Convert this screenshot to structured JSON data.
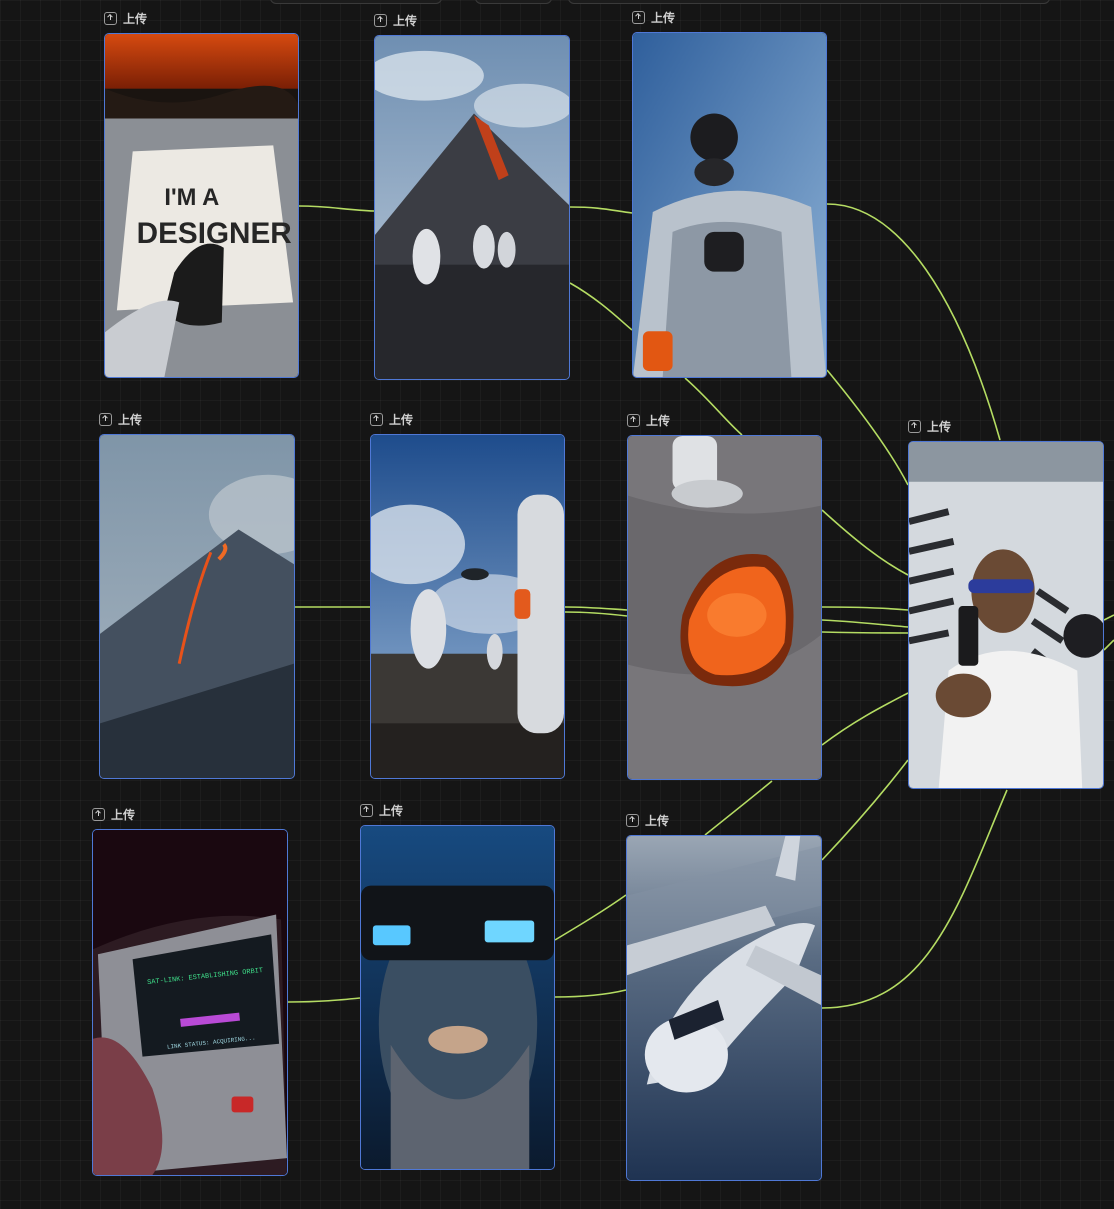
{
  "upload_label": "上传",
  "nodes": [
    {
      "id": "n1",
      "label": "上传",
      "image": "designer-sign-photo",
      "sign_text_1": "I'M A",
      "sign_text_2": "DESIGNER"
    },
    {
      "id": "n2",
      "label": "上传",
      "image": "volcano-hikers-photo"
    },
    {
      "id": "n3",
      "label": "上传",
      "image": "gas-mask-suit-photo"
    },
    {
      "id": "n4",
      "label": "上传",
      "image": "volcano-lava-flow-photo"
    },
    {
      "id": "n5",
      "label": "上传",
      "image": "astronauts-helicopter-photo"
    },
    {
      "id": "n6",
      "label": "上传",
      "image": "lava-pit-boot-photo"
    },
    {
      "id": "n7",
      "label": "上传",
      "image": "armed-man-sunglasses-photo"
    },
    {
      "id": "n8",
      "label": "上传",
      "image": "handheld-device-photo",
      "screen_line_1": "SAT-LINK: ESTABLISHING ORBIT",
      "screen_line_2": "LINK STATUS: ACQUIRING..."
    },
    {
      "id": "n9",
      "label": "上传",
      "image": "vr-headset-man-photo"
    },
    {
      "id": "n10",
      "label": "上传",
      "image": "cargo-plane-photo"
    }
  ],
  "colors": {
    "edge": "#c6f26b",
    "node_border": "#4f78d6",
    "background": "#151515",
    "label": "#cfcfcf"
  }
}
